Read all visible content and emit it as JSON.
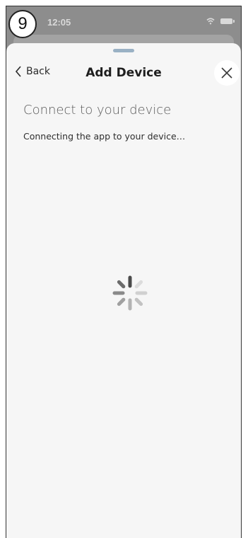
{
  "marker": {
    "label": "9"
  },
  "status_bar": {
    "time": "12:05"
  },
  "nav": {
    "back_label": "Back",
    "title": "Add Device"
  },
  "content": {
    "heading": "Connect to your device",
    "subtext": "Connecting the app to your device…"
  },
  "icons": {
    "back": "chevron-left-icon",
    "close": "close-icon",
    "spinner": "loading-spinner-icon",
    "wifi": "wifi-icon",
    "battery": "battery-icon"
  },
  "colors": {
    "sheet_background": "#f6f6f6",
    "grabber": "#9ab1c4",
    "overlay": "#8d8d8d"
  }
}
